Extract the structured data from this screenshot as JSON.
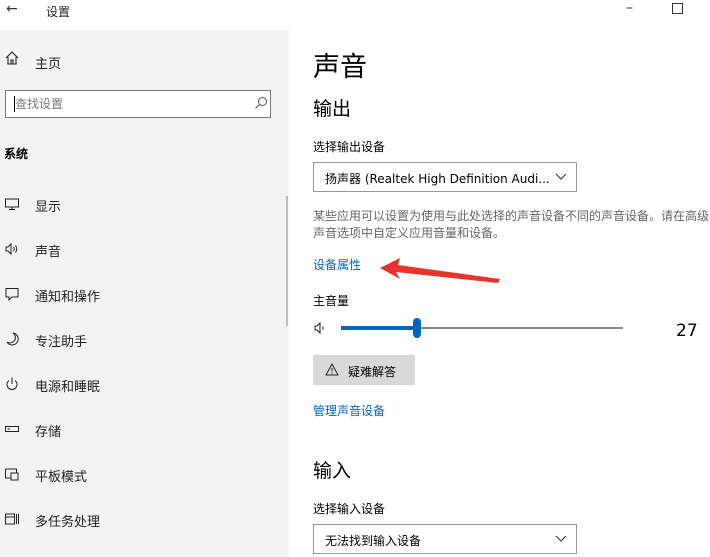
{
  "window": {
    "title": "设置",
    "back_glyph": "←",
    "minimize_glyph": "–"
  },
  "sidebar": {
    "home_label": "主页",
    "search_placeholder": "查找设置",
    "section_label": "系统",
    "items": [
      {
        "label": "显示",
        "icon": "monitor-icon"
      },
      {
        "label": "声音",
        "icon": "speaker-icon"
      },
      {
        "label": "通知和操作",
        "icon": "notification-icon"
      },
      {
        "label": "专注助手",
        "icon": "moon-icon"
      },
      {
        "label": "电源和睡眠",
        "icon": "power-icon"
      },
      {
        "label": "存储",
        "icon": "storage-icon"
      },
      {
        "label": "平板模式",
        "icon": "tablet-icon"
      },
      {
        "label": "多任务处理",
        "icon": "multitask-icon"
      }
    ]
  },
  "main": {
    "title": "声音",
    "output": {
      "heading": "输出",
      "device_label": "选择输出设备",
      "device_value": "扬声器 (Realtek High Definition Audi...",
      "description": "某些应用可以设置为使用与此处选择的声音设备不同的声音设备。请在高级声音选项中自定义应用音量和设备。",
      "properties_link": "设备属性",
      "master_volume_label": "主音量",
      "volume_value": "27",
      "volume_fraction": 0.27,
      "troubleshoot_label": "疑难解答",
      "manage_link": "管理声音设备"
    },
    "input": {
      "heading": "输入",
      "device_label": "选择输入设备",
      "device_value": "无法找到输入设备"
    }
  },
  "colors": {
    "accent": "#0067c0",
    "sidebar_bg": "#f2f2f2",
    "annotation_arrow": "#e8352b"
  }
}
